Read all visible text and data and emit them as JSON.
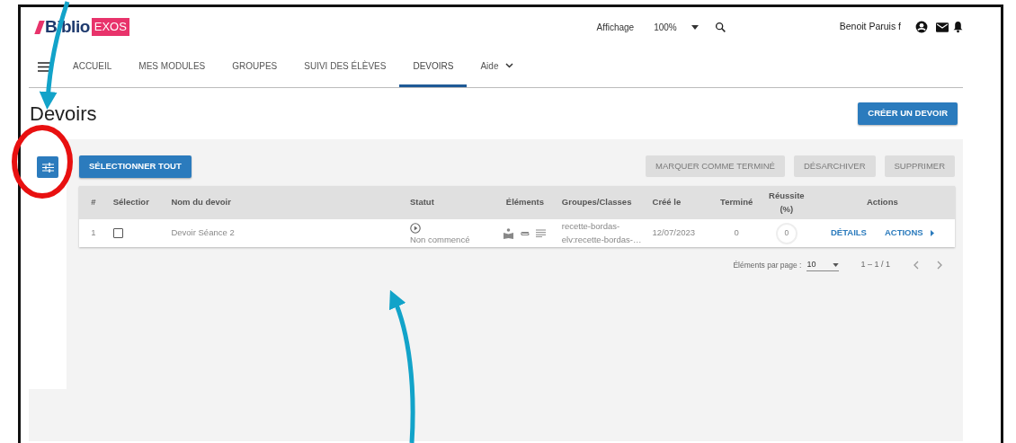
{
  "header": {
    "logo": {
      "word": "Biblio",
      "tag": "EXOS"
    },
    "display_label": "Affichage",
    "zoom": "100%",
    "user": "Benoit Paruis f"
  },
  "nav": {
    "items": [
      {
        "label": "ACCUEIL",
        "selected": false,
        "kind": "link"
      },
      {
        "label": "MES MODULES",
        "selected": false,
        "kind": "link"
      },
      {
        "label": "GROUPES",
        "selected": false,
        "kind": "link"
      },
      {
        "label": "SUIVI DES ÉLÈVES",
        "selected": false,
        "kind": "link"
      },
      {
        "label": "DEVOIRS",
        "selected": true,
        "kind": "link"
      },
      {
        "label": "Aide",
        "selected": false,
        "kind": "dropdown"
      }
    ]
  },
  "page_title": "Devoirs",
  "create_button": "CRÉER UN DEVOIR",
  "toolbar": {
    "select_all": "SÉLECTIONNER TOUT",
    "actions": [
      {
        "label": "MARQUER COMME TERMINÉ",
        "disabled": true
      },
      {
        "label": "DÉSARCHIVER",
        "disabled": true
      },
      {
        "label": "SUPPRIMER",
        "disabled": true
      }
    ]
  },
  "table": {
    "columns": [
      [
        "#"
      ],
      [
        "Sélectior"
      ],
      [
        "Nom du devoir"
      ],
      [
        "Statut"
      ],
      [
        "Éléments"
      ],
      [
        "Groupes/Classes"
      ],
      [
        "Créé le"
      ],
      [
        "Terminé"
      ],
      [
        "Réussite",
        "(%)"
      ],
      [
        "Actions"
      ]
    ],
    "rows": [
      {
        "number": "1",
        "checked": false,
        "name": "Devoir Séance 2",
        "status": "Non commencé",
        "groups": [
          "recette-bordas-",
          "elv:recette-bordas-…"
        ],
        "created": "12/07/2023",
        "completed": "0",
        "success": "0",
        "details": "DÉTAILS",
        "actions": "ACTIONS"
      }
    ]
  },
  "pagination": {
    "label": "Éléments par page :",
    "page_size": "10",
    "range": "1 – 1 / 1"
  }
}
